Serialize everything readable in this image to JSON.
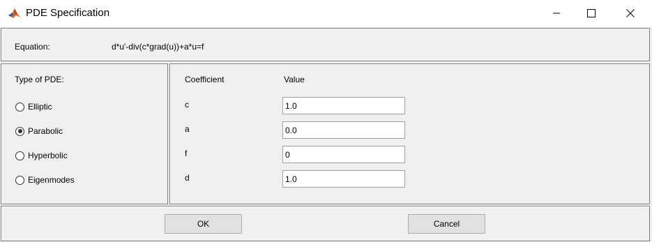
{
  "window": {
    "title": "PDE Specification",
    "icon": "matlab-icon",
    "controls": [
      "minimize-icon",
      "maximize-icon",
      "close-icon"
    ]
  },
  "equation": {
    "label": "Equation:",
    "value": "d*u'-div(c*grad(u))+a*u=f"
  },
  "pde_type": {
    "label": "Type of PDE:",
    "options": [
      {
        "label": "Elliptic",
        "checked": false
      },
      {
        "label": "Parabolic",
        "checked": true
      },
      {
        "label": "Hyperbolic",
        "checked": false
      },
      {
        "label": "Eigenmodes",
        "checked": false
      }
    ]
  },
  "coefficients": {
    "header_name": "Coefficient",
    "header_value": "Value",
    "rows": [
      {
        "name": "c",
        "value": "1.0"
      },
      {
        "name": "a",
        "value": "0.0"
      },
      {
        "name": "f",
        "value": "0"
      },
      {
        "name": "d",
        "value": "1.0"
      }
    ]
  },
  "buttons": {
    "ok": "OK",
    "cancel": "Cancel"
  },
  "colors": {
    "dialog_bg": "#f0f0f0",
    "panel_border": "#7d7d7d",
    "button_bg": "#e1e1e1"
  }
}
